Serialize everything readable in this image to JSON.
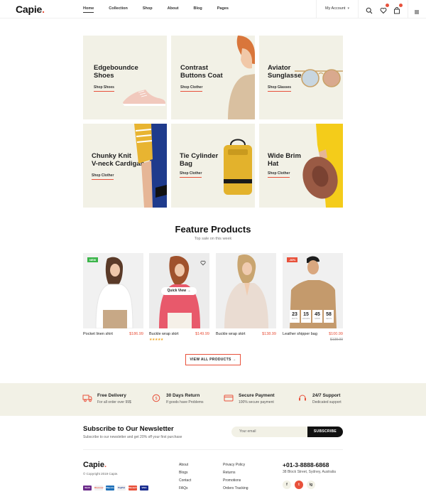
{
  "header": {
    "logo": "Capie",
    "logo_dot": ".",
    "nav": [
      "Home",
      "Collection",
      "Shop",
      "About",
      "Blog",
      "Pages"
    ],
    "account_label": "My Account",
    "account_chevron": "▾",
    "icons": [
      "search-icon",
      "heart-icon",
      "bag-icon",
      "menu-icon"
    ]
  },
  "categories": [
    {
      "title_lines": [
        "Edgeboundce",
        "Shoes"
      ],
      "link": "Shop Shoes"
    },
    {
      "title_lines": [
        "Contrast",
        "Buttons Coat"
      ],
      "link": "Shop Clother"
    },
    {
      "title_lines": [
        "Aviator",
        "Sunglasses"
      ],
      "link": "Shop Glasses"
    },
    {
      "title_lines": [
        "Chunky Knit",
        "V-neck Cardigan"
      ],
      "link": "Shop Clother"
    },
    {
      "title_lines": [
        "Tie Cylinder",
        "Bag"
      ],
      "link": "Shop Clother"
    },
    {
      "title_lines": [
        "Wide Brim",
        "Hat"
      ],
      "link": "Shop Clother"
    }
  ],
  "feature": {
    "title": "Feature Products",
    "subtitle": "Top sale on this week",
    "products": [
      {
        "name": "Pocket linen shirt",
        "price": "$186.99",
        "badge": "NEW",
        "badge_color": "#3bb54a"
      },
      {
        "name": "Buckle wrap skirt",
        "price": "$149.99",
        "quick_view": "Quick View →",
        "rating": "★★★★★"
      },
      {
        "name": "Buckle wrap skirt",
        "price": "$138.99"
      },
      {
        "name": "Leather shipper bag",
        "price": "$100.99",
        "old_price": "$138.99",
        "badge": "-30%",
        "badge_color": "#e8513b",
        "countdown": [
          {
            "v": "23",
            "l": "DAYS"
          },
          {
            "v": "15",
            "l": "HOURS"
          },
          {
            "v": "45",
            "l": "MINS"
          },
          {
            "v": "58",
            "l": "SECS"
          }
        ]
      }
    ],
    "view_all": "VIEW ALL PRODUCTS →"
  },
  "services": [
    {
      "title": "Free Delivery",
      "sub": "For all order over 99$",
      "icon": "truck-icon"
    },
    {
      "title": "30 Days Return",
      "sub": "If goods have Problems",
      "icon": "return-icon"
    },
    {
      "title": "Secure Payment",
      "sub": "100% secure payment",
      "icon": "card-icon"
    },
    {
      "title": "24/7 Support",
      "sub": "Dedicated support",
      "icon": "support-icon"
    }
  ],
  "newsletter": {
    "title": "Subscribe to Our Newsletter",
    "subtitle": "Subscribe to our newsletter and get 20% off your first purchase",
    "placeholder": "Your email",
    "button": "SUBSCRIBE"
  },
  "footer": {
    "logo": "Capie",
    "copyright": "© Copyright 2019 Capie.",
    "payments": [
      "Skrill",
      "Discover",
      "Maestro",
      "PayPal",
      "MasterCard",
      "VISA"
    ],
    "col1": [
      "About",
      "Blogs",
      "Contact",
      "FAQs"
    ],
    "col2": [
      "Privacy Policy",
      "Returns",
      "Promotions",
      "Orders Tracking"
    ],
    "phone": "+01-3-8888-6868",
    "address": "38 Block Street, Sydney, Australia",
    "social": [
      "f",
      "t",
      "ig"
    ]
  },
  "colors": {
    "accent": "#e8513b",
    "cream": "#f2f1e6",
    "dark": "#111111"
  }
}
